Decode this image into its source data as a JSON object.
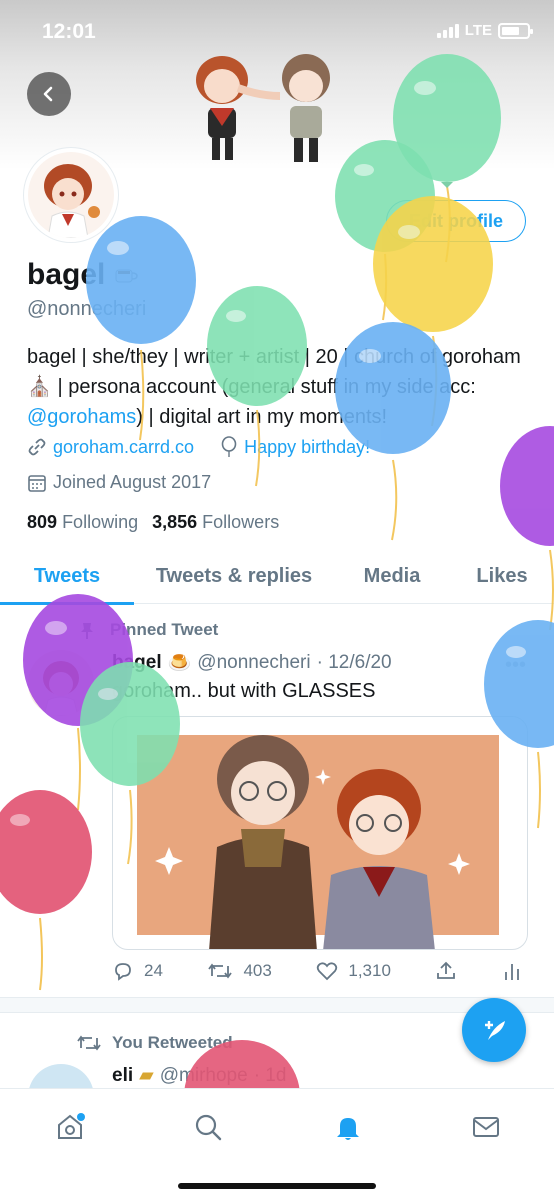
{
  "status_bar": {
    "time": "12:01",
    "network": "LTE"
  },
  "profile": {
    "display_name": "bagel",
    "handle": "@nonnecheri",
    "edit_button": "Edit profile",
    "bio_part1": "bagel | she/they | writer + artist | 20 | church of goroham ",
    "bio_part2": " | persona account (general stuff in my side acc: ",
    "bio_link": "@gorohams",
    "bio_part3": ") | digital art in my moments!",
    "website": "goroham.carrd.co",
    "birthday": "Happy birthday!",
    "joined": "Joined August 2017",
    "following_count": "809",
    "following_label": "Following",
    "followers_count": "3,856",
    "followers_label": "Followers"
  },
  "tabs": [
    {
      "label": "Tweets",
      "active": true
    },
    {
      "label": "Tweets & replies",
      "active": false
    },
    {
      "label": "Media",
      "active": false
    },
    {
      "label": "Likes",
      "active": false
    }
  ],
  "pinned_tweet": {
    "label": "Pinned Tweet",
    "name": "bagel",
    "handle": "@nonnecheri",
    "date": "· 12/6/20",
    "text": "goroham.. but with GLASSES",
    "replies": "24",
    "retweets": "403",
    "likes": "1,310"
  },
  "retweet": {
    "label": "You Retweeted",
    "name": "eli",
    "handle": "@mirhope",
    "time": "· 1d"
  },
  "icons": {
    "back": "chevron-left-icon",
    "link": "link-icon",
    "birthday": "balloon-icon",
    "calendar": "calendar-icon",
    "compose": "compose-feather-icon",
    "nav": [
      "home-icon",
      "search-icon",
      "notifications-bell-icon",
      "messages-icon"
    ]
  },
  "colors": {
    "accent": "#1da1f2",
    "muted": "#657786",
    "balloon_green": "#7ee0b0",
    "balloon_blue": "#6ab1f3",
    "balloon_yellow": "#f6d44a",
    "balloon_purple": "#a64ae0",
    "balloon_red": "#e25574"
  }
}
